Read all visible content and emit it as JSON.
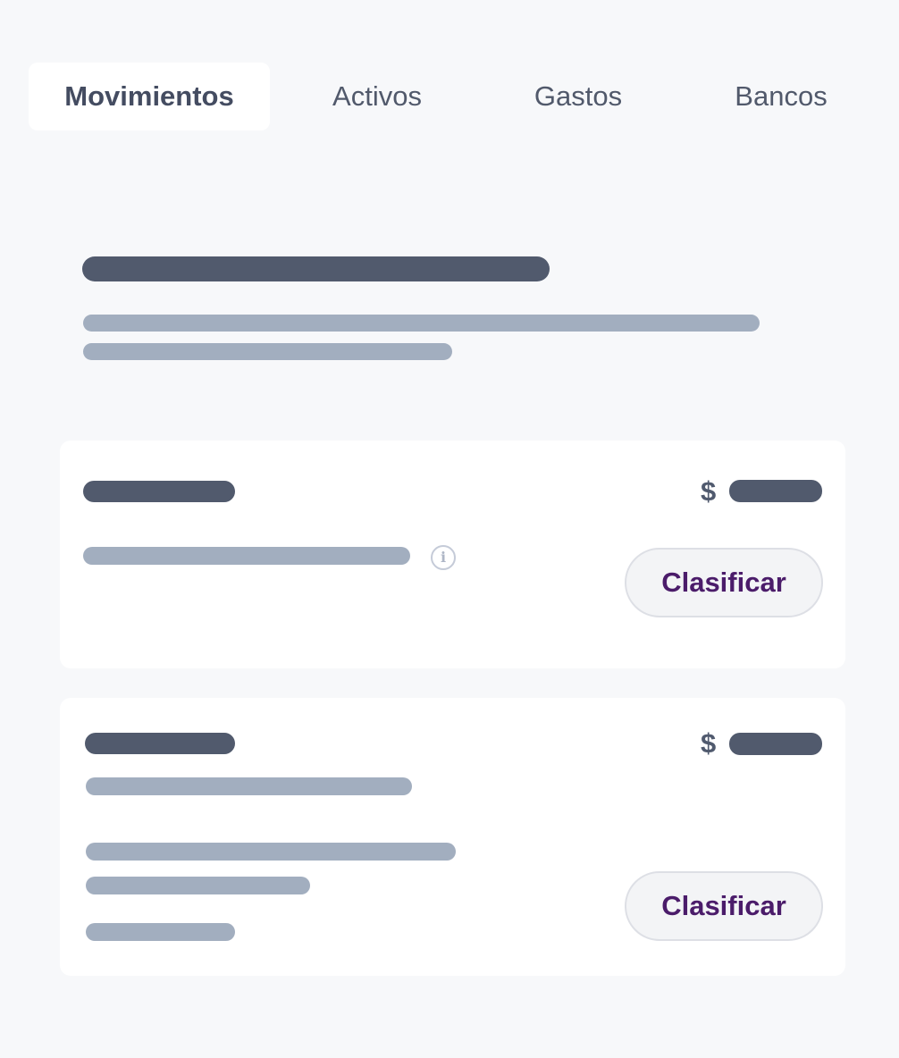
{
  "tabs": [
    {
      "label": "Movimientos",
      "active": true
    },
    {
      "label": "Activos",
      "active": false
    },
    {
      "label": "Gastos",
      "active": false
    },
    {
      "label": "Bancos",
      "active": false
    }
  ],
  "cards": [
    {
      "currency": "$",
      "button_label": "Clasificar",
      "info_icon": "info-icon"
    },
    {
      "currency": "$",
      "button_label": "Clasificar"
    }
  ],
  "colors": {
    "background": "#f7f8fa",
    "card": "#ffffff",
    "placeholder_dark": "#515a6d",
    "placeholder_light": "#a2aebf",
    "button_text": "#4b1c6a"
  }
}
